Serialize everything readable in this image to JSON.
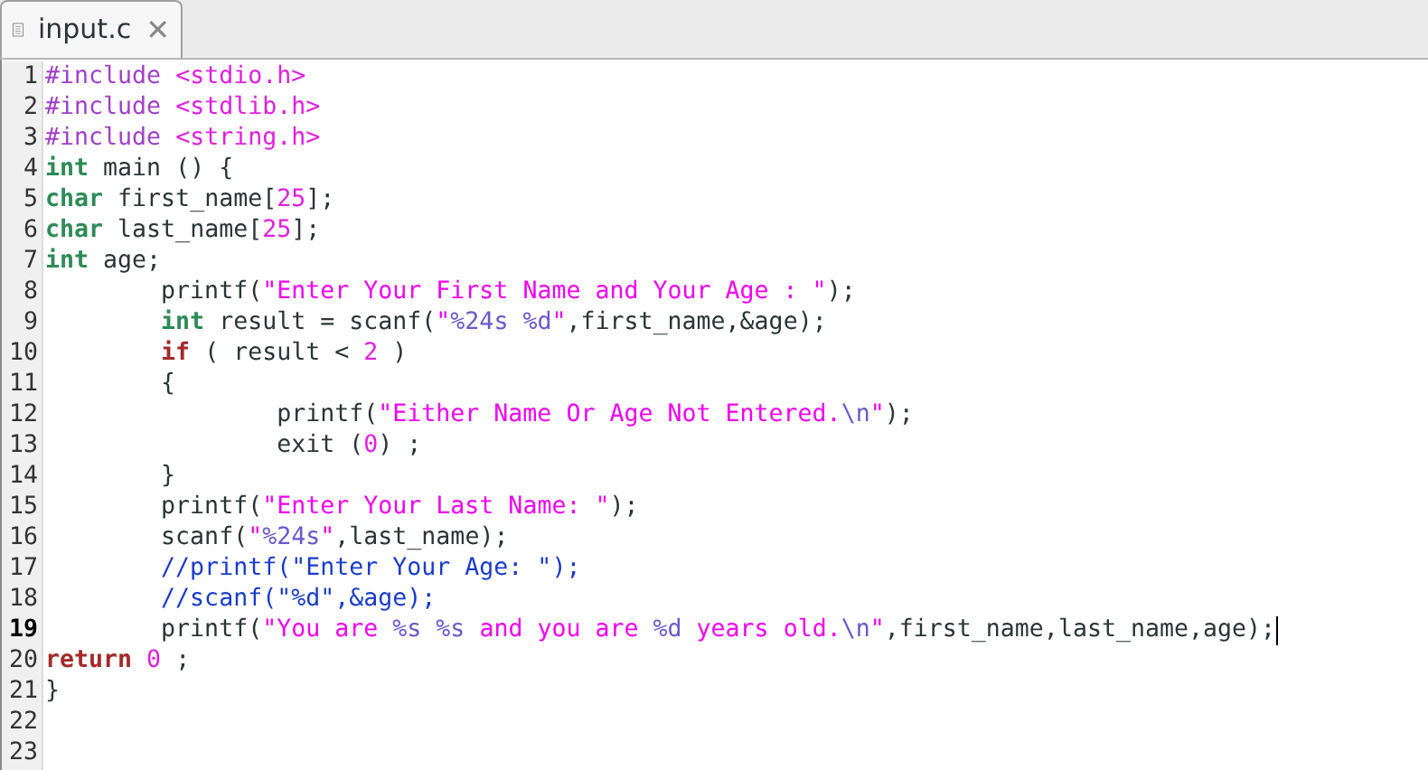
{
  "tab": {
    "title": "input.c",
    "close": "✕",
    "selected": true
  },
  "lines": [
    {
      "number": "1",
      "current": false,
      "tokens": [
        {
          "kind": "preproc",
          "text": "#include "
        },
        {
          "kind": "header",
          "text": "<stdio.h>"
        }
      ]
    },
    {
      "number": "2",
      "current": false,
      "tokens": [
        {
          "kind": "preproc",
          "text": "#include "
        },
        {
          "kind": "header",
          "text": "<stdlib.h>"
        }
      ]
    },
    {
      "number": "3",
      "current": false,
      "tokens": [
        {
          "kind": "preproc",
          "text": "#include "
        },
        {
          "kind": "header",
          "text": "<string.h>"
        }
      ]
    },
    {
      "number": "4",
      "current": false,
      "tokens": [
        {
          "kind": "type",
          "text": "int"
        },
        {
          "kind": "plain",
          "text": " main () {"
        }
      ]
    },
    {
      "number": "5",
      "current": false,
      "tokens": [
        {
          "kind": "type",
          "text": "char"
        },
        {
          "kind": "plain",
          "text": " first_name["
        },
        {
          "kind": "number",
          "text": "25"
        },
        {
          "kind": "plain",
          "text": "];"
        }
      ]
    },
    {
      "number": "6",
      "current": false,
      "tokens": [
        {
          "kind": "type",
          "text": "char"
        },
        {
          "kind": "plain",
          "text": " last_name["
        },
        {
          "kind": "number",
          "text": "25"
        },
        {
          "kind": "plain",
          "text": "];"
        }
      ]
    },
    {
      "number": "7",
      "current": false,
      "tokens": [
        {
          "kind": "type",
          "text": "int"
        },
        {
          "kind": "plain",
          "text": " age;"
        }
      ]
    },
    {
      "number": "8",
      "current": false,
      "tokens": [
        {
          "kind": "plain",
          "text": "        printf("
        },
        {
          "kind": "string",
          "text": "\"Enter Your First Name and Your Age : \""
        },
        {
          "kind": "plain",
          "text": ");"
        }
      ]
    },
    {
      "number": "9",
      "current": false,
      "tokens": [
        {
          "kind": "type",
          "text": "        int"
        },
        {
          "kind": "plain",
          "text": " result = scanf("
        },
        {
          "kind": "string",
          "text": "\""
        },
        {
          "kind": "format",
          "text": "%24s %d"
        },
        {
          "kind": "string",
          "text": "\""
        },
        {
          "kind": "plain",
          "text": ",first_name,&age);"
        }
      ]
    },
    {
      "number": "10",
      "current": false,
      "tokens": [
        {
          "kind": "keyword",
          "text": "        if"
        },
        {
          "kind": "plain",
          "text": " ( result < "
        },
        {
          "kind": "number",
          "text": "2"
        },
        {
          "kind": "plain",
          "text": " )"
        }
      ]
    },
    {
      "number": "11",
      "current": false,
      "tokens": [
        {
          "kind": "plain",
          "text": "        {"
        }
      ]
    },
    {
      "number": "12",
      "current": false,
      "tokens": [
        {
          "kind": "plain",
          "text": "                printf("
        },
        {
          "kind": "string",
          "text": "\"Either Name Or Age Not Entered."
        },
        {
          "kind": "format",
          "text": "\\n"
        },
        {
          "kind": "string",
          "text": "\""
        },
        {
          "kind": "plain",
          "text": ");"
        }
      ]
    },
    {
      "number": "13",
      "current": false,
      "tokens": [
        {
          "kind": "plain",
          "text": "                exit ("
        },
        {
          "kind": "number",
          "text": "0"
        },
        {
          "kind": "plain",
          "text": ") ;"
        }
      ]
    },
    {
      "number": "14",
      "current": false,
      "tokens": [
        {
          "kind": "plain",
          "text": "        }"
        }
      ]
    },
    {
      "number": "15",
      "current": false,
      "tokens": [
        {
          "kind": "plain",
          "text": "        printf("
        },
        {
          "kind": "string",
          "text": "\"Enter Your Last Name: \""
        },
        {
          "kind": "plain",
          "text": ");"
        }
      ]
    },
    {
      "number": "16",
      "current": false,
      "tokens": [
        {
          "kind": "plain",
          "text": "        scanf("
        },
        {
          "kind": "string",
          "text": "\""
        },
        {
          "kind": "format",
          "text": "%24s"
        },
        {
          "kind": "string",
          "text": "\""
        },
        {
          "kind": "plain",
          "text": ",last_name);"
        }
      ]
    },
    {
      "number": "17",
      "current": false,
      "tokens": [
        {
          "kind": "comment",
          "text": "        //printf(\"Enter Your Age: \");"
        }
      ]
    },
    {
      "number": "18",
      "current": false,
      "tokens": [
        {
          "kind": "comment",
          "text": "        //scanf(\"%d\",&age);"
        }
      ]
    },
    {
      "number": "19",
      "current": true,
      "tokens": [
        {
          "kind": "plain",
          "text": "        printf("
        },
        {
          "kind": "string",
          "text": "\"You are "
        },
        {
          "kind": "format",
          "text": "%s %s"
        },
        {
          "kind": "string",
          "text": " and you are "
        },
        {
          "kind": "format",
          "text": "%d"
        },
        {
          "kind": "string",
          "text": " years old."
        },
        {
          "kind": "format",
          "text": "\\n"
        },
        {
          "kind": "string",
          "text": "\""
        },
        {
          "kind": "plain",
          "text": ",first_name,last_name,age);"
        }
      ]
    },
    {
      "number": "20",
      "current": false,
      "tokens": [
        {
          "kind": "keyword",
          "text": "return "
        },
        {
          "kind": "number",
          "text": "0"
        },
        {
          "kind": "plain",
          "text": " ;"
        }
      ]
    },
    {
      "number": "21",
      "current": false,
      "tokens": [
        {
          "kind": "plain",
          "text": "}"
        }
      ]
    },
    {
      "number": "22",
      "current": false
    },
    {
      "number": "23",
      "current": false
    }
  ]
}
